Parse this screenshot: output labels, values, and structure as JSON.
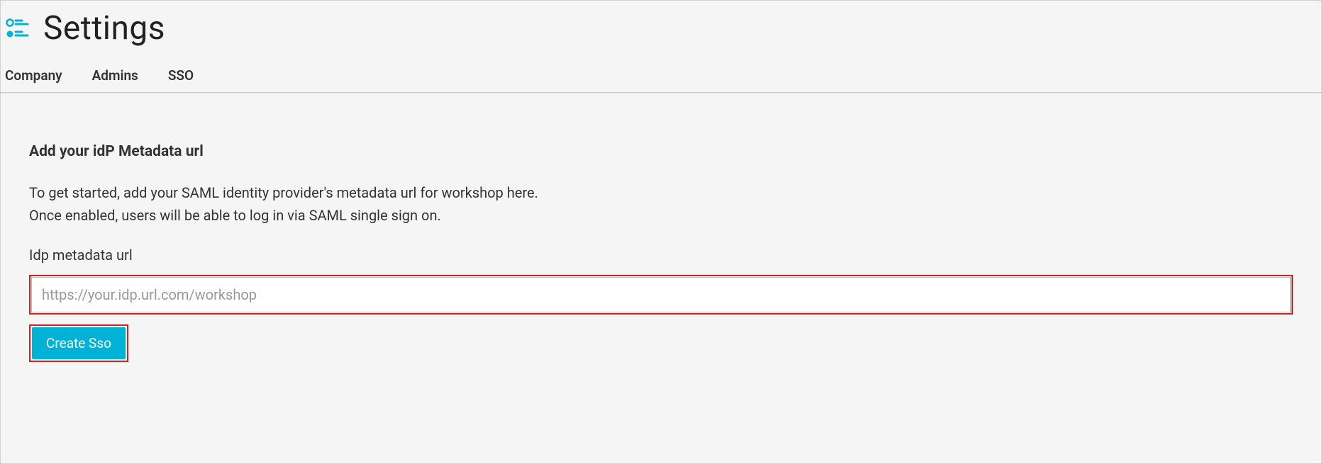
{
  "page": {
    "title": "Settings"
  },
  "tabs": {
    "company": "Company",
    "admins": "Admins",
    "sso": "SSO"
  },
  "sso": {
    "heading": "Add your idP Metadata url",
    "description_line1": "To get started, add your SAML identity provider's metadata url for workshop here.",
    "description_line2": "Once enabled, users will be able to log in via SAML single sign on.",
    "input_label": "Idp metadata url",
    "input_placeholder": "https://your.idp.url.com/workshop",
    "button_label": "Create Sso"
  },
  "colors": {
    "accent": "#00b3d6",
    "highlight_outline": "#d22020"
  }
}
